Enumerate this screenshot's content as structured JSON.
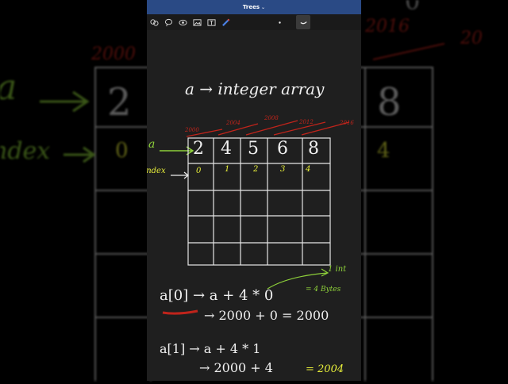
{
  "window": {
    "title": "Trees"
  },
  "toolbar": {
    "tools": [
      "select-tool",
      "lasso-tool",
      "eye-tool",
      "image-tool",
      "text-tool",
      "pen-tool",
      "color-dot",
      "stroke-preview"
    ]
  },
  "heading": {
    "text": "a → integer array"
  },
  "labels": {
    "a": "a",
    "index": "index"
  },
  "array": {
    "values": [
      "2",
      "4",
      "5",
      "6",
      "8"
    ],
    "indices": [
      "0",
      "1",
      "2",
      "3",
      "4"
    ],
    "addresses": [
      "2000",
      "2004",
      "2008",
      "2012",
      "2016"
    ]
  },
  "notes": {
    "one_int": "1 int",
    "bytes": "= 4 Bytes",
    "line1": "a[0]  →  a + 4 * 0",
    "line2": "→ 2000 + 0 = 2000",
    "line3": "a[1] →  a + 4 * 1",
    "line4_left": "→  2000 + 4 ",
    "line4_right": "= 2004"
  },
  "colors": {
    "green": "#8ed13a",
    "red": "#c0241b",
    "yellow": "#e8ef3a",
    "chalk": "#f2f2f2",
    "titlebar": "#2a4a85"
  }
}
